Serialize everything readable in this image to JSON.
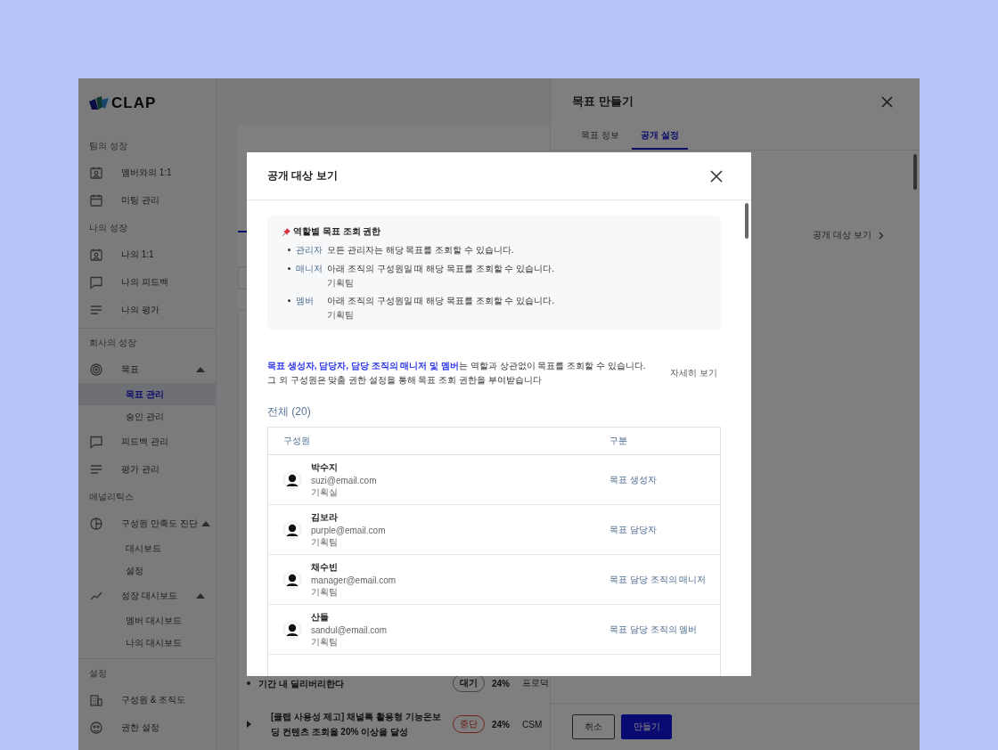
{
  "logo": {
    "text": "CLAP"
  },
  "sidebar": {
    "sections": [
      {
        "title": "팀의 성장",
        "divider_above": false,
        "items": [
          {
            "label": "멤버와의 1:1",
            "kind": "person-calendar",
            "selected": false
          },
          {
            "label": "미팅 관리",
            "kind": "calendar",
            "selected": false
          }
        ]
      },
      {
        "title": "나의 성장",
        "divider_above": false,
        "items": [
          {
            "label": "나의 1:1",
            "kind": "person-calendar",
            "selected": false
          },
          {
            "label": "나의 피드백",
            "kind": "chat",
            "selected": false
          },
          {
            "label": "나의 평가",
            "kind": "lines",
            "selected": false
          }
        ]
      },
      {
        "title": "회사의 성장",
        "divider_above": true,
        "items": [
          {
            "label": "목표",
            "kind": "target",
            "selected": false,
            "expanded": true,
            "children": [
              {
                "label": "목표 관리",
                "selected": true
              },
              {
                "label": "승인 관리",
                "selected": false
              }
            ]
          },
          {
            "label": "피드백 관리",
            "kind": "chat",
            "selected": false
          },
          {
            "label": "평가 관리",
            "kind": "lines",
            "selected": false
          }
        ]
      },
      {
        "title": "애널리틱스",
        "divider_above": false,
        "items": [
          {
            "label": "구성원 만족도 진단",
            "kind": "pie",
            "selected": false,
            "expanded": true,
            "children": [
              {
                "label": "대시보드",
                "selected": false
              },
              {
                "label": "설정",
                "selected": false
              }
            ]
          },
          {
            "label": "성장 대시보드",
            "kind": "trend",
            "selected": false,
            "expanded": true,
            "children": [
              {
                "label": "멤버 대시보드",
                "selected": false
              },
              {
                "label": "나의 대시보드",
                "selected": false
              }
            ]
          }
        ]
      },
      {
        "title": "설정",
        "divider_above": true,
        "items": [
          {
            "label": "구성원 & 조직도",
            "kind": "building",
            "selected": false
          },
          {
            "label": "권한 설정",
            "kind": "people",
            "selected": false
          }
        ]
      }
    ]
  },
  "main": {
    "goals": [
      {
        "title": "기간 내 딜리버리한다",
        "status": "대기",
        "kind": "waiting",
        "progress": "24%",
        "team": "프로덕",
        "expandable": false
      },
      {
        "title": "[클랩 사용성 제고] 채널톡 활용형 기능온보딩 컨텐츠 조회율 20% 이상을 달성",
        "status": "중단",
        "kind": "stopped",
        "progress": "24%",
        "team": "CSM",
        "expandable": true
      }
    ]
  },
  "drawer": {
    "title": "목표 만들기",
    "tabs": [
      {
        "label": "목표 정보",
        "selected": false
      },
      {
        "label": "공개 설정",
        "selected": true
      }
    ],
    "audience_link": "공개 대상 보기",
    "buttons": [
      {
        "label": "취소",
        "kind": "secondary"
      },
      {
        "label": "만들기",
        "kind": "primary"
      }
    ]
  },
  "modal": {
    "title": "공개 대상 보기",
    "info": {
      "title": "역할별 목표 조회 권한",
      "roles": [
        {
          "role": "관리자",
          "desc": "모든 관리자는 해당 목표를 조회할 수 있습니다."
        },
        {
          "role": "매니저",
          "desc": "아래 조직의 구성원일 때 해당 목표를 조회할 수 있습니다.",
          "team": "기획팀"
        },
        {
          "role": "멤버",
          "desc": "아래 조직의 구성원일 때 해당 목표를 조회할 수 있습니다.",
          "team": "기획팀"
        }
      ]
    },
    "note": [
      "**목표 생성자, 담당자, 담당 조직의 매니저 및 멤버**는 역할과 상관없이 목표를 조회할 수 있습니다.",
      "그 외 구성원은 맞춤 권한 설정을 통해 목표 조회 권한을 부여받습니다"
    ],
    "detail_link": "자세히 보기",
    "count_heading": "전체 (20)",
    "table": {
      "columns": [
        "구성원",
        "구분"
      ],
      "rows": [
        {
          "name": "박수지",
          "email": "suzi@email.com",
          "team": "기획실",
          "role": "목표 생성자"
        },
        {
          "name": "김보라",
          "email": "purple@email.com",
          "team": "기획팀",
          "role": "목표 담당자"
        },
        {
          "name": "채수빈",
          "email": "manager@email.com",
          "team": "기획팀",
          "role": "목표 담당 조직의 매니저"
        },
        {
          "name": "산들",
          "email": "sandul@email.com",
          "team": "기획팀",
          "role": "목표 담당 조직의 멤버"
        }
      ]
    }
  }
}
